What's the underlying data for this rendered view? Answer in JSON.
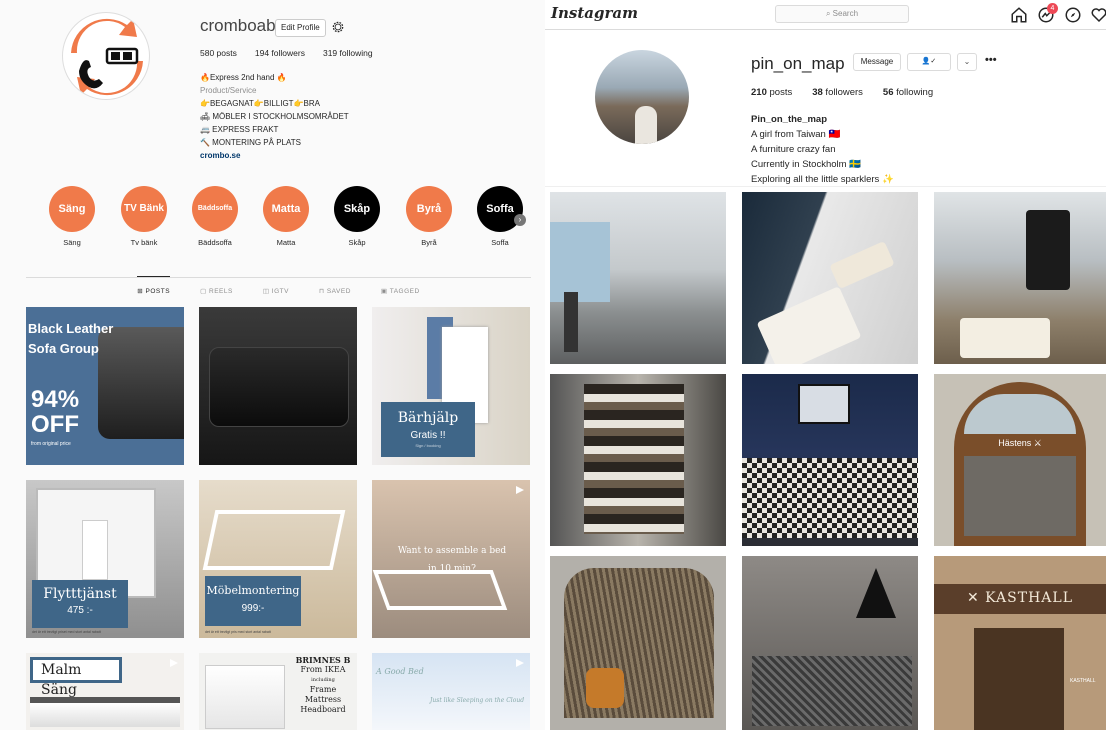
{
  "left": {
    "username": "cromboab",
    "edit_profile": "Edit Profile",
    "stats": {
      "posts": "580 posts",
      "followers": "194 followers",
      "following": "319 following"
    },
    "bio": {
      "name": "🔥Express 2nd hand 🔥",
      "category": "Product/Service",
      "lines": [
        "👉BEGAGNAT👉BILLIGT👉BRA",
        "🛋 MÖBLER I STOCKHOLMSOMRÅDET",
        "🚐 EXPRESS FRAKT",
        "🔨 MONTERING PÅ PLATS"
      ],
      "link": "crombo.se"
    },
    "highlights": [
      {
        "title": "Säng",
        "label": "Säng",
        "style": "o"
      },
      {
        "title": "TV Bänk",
        "label": "Tv bänk",
        "style": "o"
      },
      {
        "title": "Bäddsoffa",
        "label": "Bäddsoffa",
        "style": "o"
      },
      {
        "title": "Matta",
        "label": "Matta",
        "style": "o"
      },
      {
        "title": "Skåp",
        "label": "Skåp",
        "style": "b"
      },
      {
        "title": "Byrå",
        "label": "Byrå",
        "style": "o"
      },
      {
        "title": "Soffa",
        "label": "Soffa",
        "style": "b"
      }
    ],
    "tabs": [
      "⊞ POSTS",
      "▢ REELS",
      "◫ IGTV",
      "⊓ SAVED",
      "▣ TAGGED"
    ],
    "posts": {
      "p1": {
        "l1": "Black Leather",
        "l2": "Sofa Group",
        "big": "94%",
        "off": "OFF",
        "small": "from original price"
      },
      "p3": {
        "title": "Bärhjälp",
        "sub": "Gratis !!",
        "tiny": "Sign / booking"
      },
      "p4": {
        "title": "Flytttjänst",
        "price": "475 :-",
        "tiny": "det är ett trevligt priset med stort antal rabatt"
      },
      "p5": {
        "title": "Möbelmontering",
        "price": "999:-",
        "tiny": "det är ett trevligt pris med stort antal rabatt"
      },
      "p6": {
        "l1": "Want to assemble a bed",
        "l2": "in 10 min?"
      },
      "p7": {
        "title": "Malm Säng"
      },
      "p8": {
        "l1": "BRIMNES B",
        "l2": "From IKEA",
        "l3": "including",
        "l4": "Frame",
        "l5": "Mattress",
        "l6": "Headboard"
      },
      "p9": {
        "l1": "A Good Bed",
        "l2": "Just like Sleeping on the Cloud"
      }
    }
  },
  "right": {
    "logo": "Instagram",
    "search_placeholder": "Search",
    "notif_count": "4",
    "username": "pin_on_map",
    "message_btn": "Message",
    "follow_icon": "👤✓",
    "more_dots": "•••",
    "chevron": "⌄",
    "stats": {
      "posts_n": "210",
      "posts_l": " posts",
      "followers_n": "38",
      "followers_l": " followers",
      "following_n": "56",
      "following_l": " following"
    },
    "bio": {
      "name": "Pin_on_the_map",
      "lines": [
        "A girl from Taiwan 🇹🇼",
        "A furniture crazy fan",
        "Currently in Stockholm 🇸🇪",
        "Exploring all the little sparklers ✨"
      ]
    },
    "signs": {
      "hastens": "Hästens ⚔",
      "kasthall": "✕ KASTHALL",
      "kasthall_small": "KASTHALL"
    }
  }
}
